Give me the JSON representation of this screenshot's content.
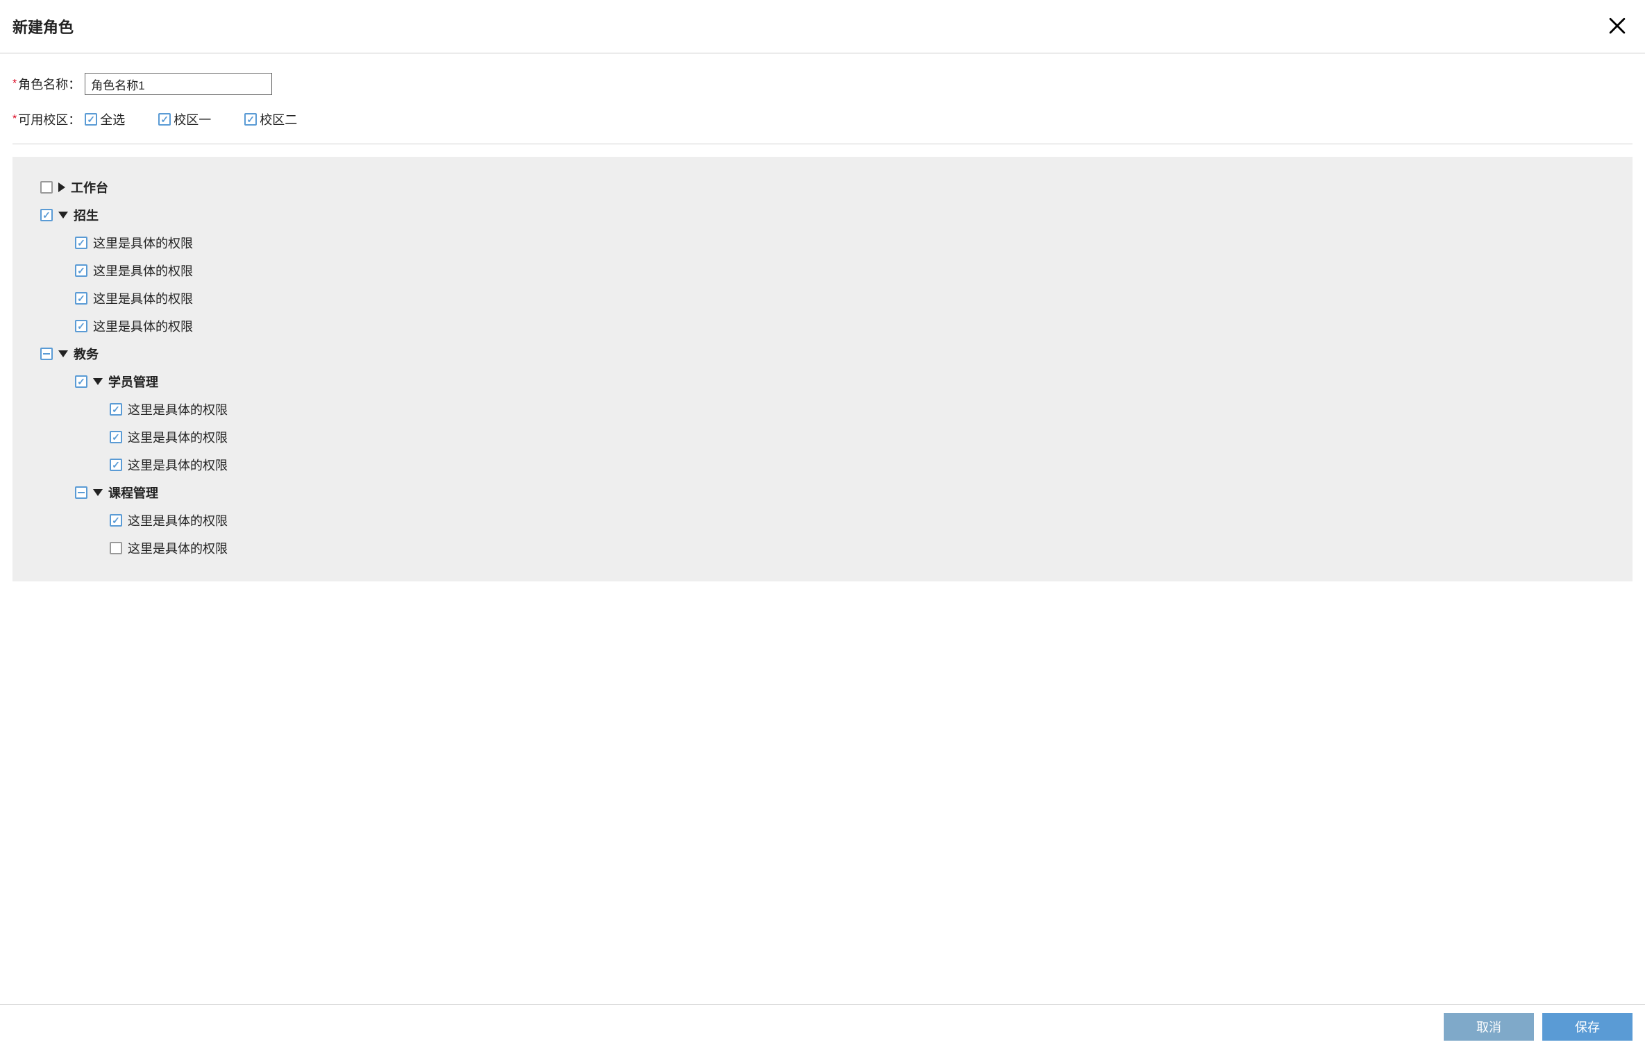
{
  "dialog": {
    "title": "新建角色"
  },
  "form": {
    "role_name_label": "角色名称：",
    "role_name_value": "角色名称1",
    "campus_label": "可用校区：",
    "campus_select_all": "全选",
    "campus_options": [
      {
        "label": "校区一",
        "checked": true
      },
      {
        "label": "校区二",
        "checked": true
      }
    ]
  },
  "tree": {
    "nodes": [
      {
        "label": "工作台",
        "checked": false,
        "expanded": false
      },
      {
        "label": "招生",
        "checked": true,
        "expanded": true,
        "children": [
          {
            "label": "这里是具体的权限",
            "checked": true
          },
          {
            "label": "这里是具体的权限",
            "checked": true
          },
          {
            "label": "这里是具体的权限",
            "checked": true
          },
          {
            "label": "这里是具体的权限",
            "checked": true
          }
        ]
      },
      {
        "label": "教务",
        "indeterminate": true,
        "expanded": true,
        "children": [
          {
            "label": "学员管理",
            "checked": true,
            "expanded": true,
            "children": [
              {
                "label": "这里是具体的权限",
                "checked": true
              },
              {
                "label": "这里是具体的权限",
                "checked": true
              },
              {
                "label": "这里是具体的权限",
                "checked": true
              }
            ]
          },
          {
            "label": "课程管理",
            "indeterminate": true,
            "expanded": true,
            "children": [
              {
                "label": "这里是具体的权限",
                "checked": true
              },
              {
                "label": "这里是具体的权限",
                "checked": false
              }
            ]
          }
        ]
      }
    ]
  },
  "footer": {
    "cancel_label": "取消",
    "save_label": "保存"
  }
}
